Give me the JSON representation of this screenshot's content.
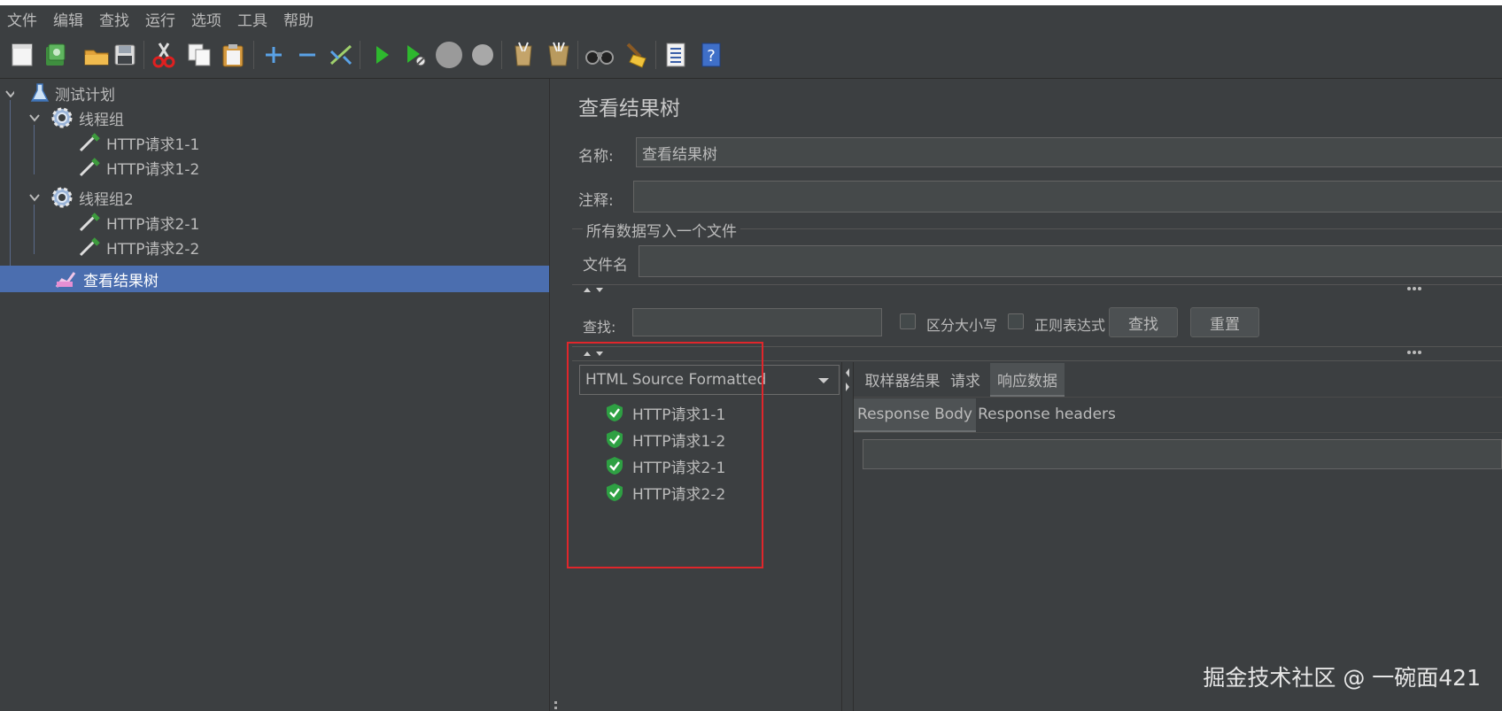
{
  "menu": [
    "文件",
    "编辑",
    "查找",
    "运行",
    "选项",
    "工具",
    "帮助"
  ],
  "toolbar": {
    "icons": [
      "new-icon",
      "templates-icon",
      "open-icon",
      "save-icon",
      "cut-icon",
      "copy-icon",
      "paste-icon",
      "expand-icon",
      "collapse-icon",
      "toggle-icon",
      "start-icon",
      "start-no-pause-icon",
      "stop-icon",
      "shutdown-icon",
      "clear-icon",
      "clear-all-icon",
      "search-icon",
      "reset-search-icon",
      "function-helper-icon",
      "help-icon"
    ]
  },
  "tree": {
    "root": "测试计划",
    "group1": "线程组",
    "req1_1": "HTTP请求1-1",
    "req1_2": "HTTP请求1-2",
    "group2": "线程组2",
    "req2_1": "HTTP请求2-1",
    "req2_2": "HTTP请求2-2",
    "listener": "查看结果树"
  },
  "panel": {
    "title": "查看结果树",
    "name_label": "名称:",
    "name_value": "查看结果树",
    "comment_label": "注释:",
    "comment_value": "",
    "file_section": "所有数据写入一个文件",
    "filename_label": "文件名",
    "filename_value": ""
  },
  "search": {
    "label": "查找:",
    "value": "",
    "case_sensitive": "区分大小写",
    "regex": "正则表达式",
    "find_button": "查找",
    "reset_button": "重置"
  },
  "renderer": {
    "selected": "HTML Source Formatted"
  },
  "results": [
    "HTTP请求1-1",
    "HTTP请求1-2",
    "HTTP请求2-1",
    "HTTP请求2-2"
  ],
  "detail_tabs": [
    "取样器结果",
    "请求",
    "响应数据"
  ],
  "response_tabs": [
    "Response Body",
    "Response headers"
  ],
  "watermark": "掘金技术社区 @ 一碗面421",
  "colors": {
    "selection": "#4b6eaf",
    "background": "#3c3f41",
    "highlight_box": "#e0262b",
    "success": "#2ea043"
  }
}
